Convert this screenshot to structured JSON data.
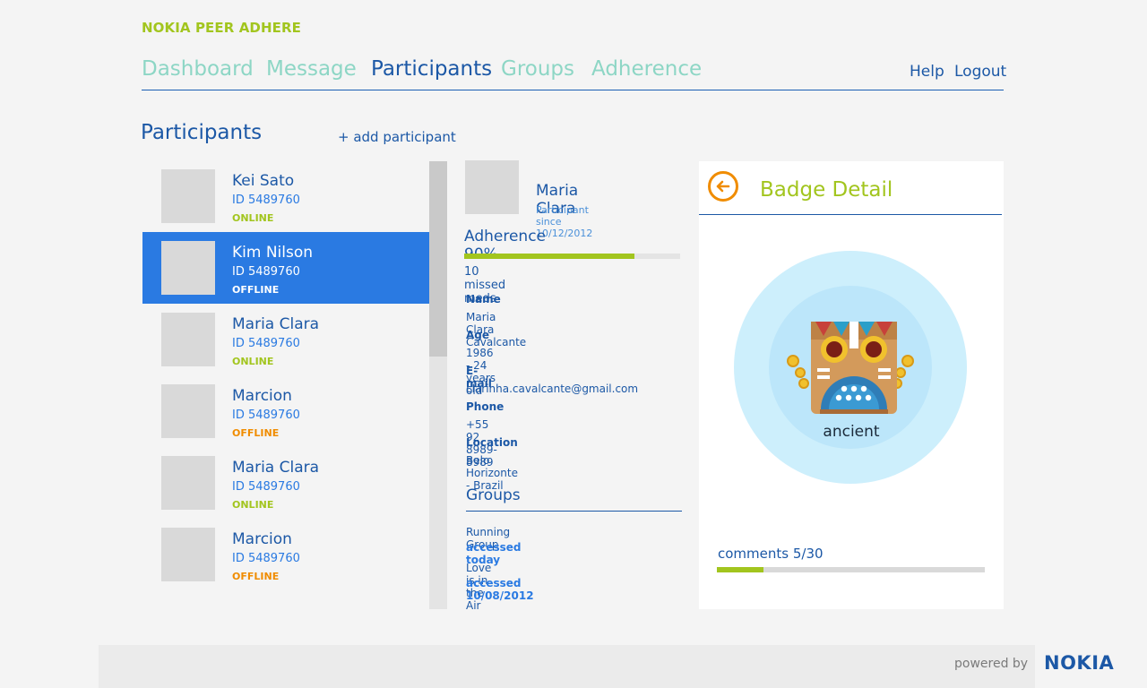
{
  "app": {
    "title": "NOKIA PEER ADHERE"
  },
  "nav": {
    "tabs": [
      {
        "label": "Dashboard",
        "active": false
      },
      {
        "label": "Message",
        "active": false
      },
      {
        "label": "Participants",
        "active": true
      },
      {
        "label": "Groups",
        "active": false
      },
      {
        "label": "Adherence",
        "active": false
      }
    ],
    "help": "Help",
    "logout": "Logout"
  },
  "participants": {
    "title": "Participants",
    "add_label": "+ add participant",
    "items": [
      {
        "name": "Kei Sato",
        "id": "ID 5489760",
        "status": "ONLINE",
        "selected": false
      },
      {
        "name": "Kim Nilson",
        "id": "ID 5489760",
        "status": "OFFLINE",
        "selected": true
      },
      {
        "name": "Maria Clara",
        "id": "ID 5489760",
        "status": "ONLINE",
        "selected": false
      },
      {
        "name": "Marcion",
        "id": "ID 5489760",
        "status": "OFFLINE",
        "selected": false
      },
      {
        "name": "Maria Clara",
        "id": "ID 5489760",
        "status": "ONLINE",
        "selected": false
      },
      {
        "name": "Marcion",
        "id": "ID 5489760",
        "status": "OFFLINE",
        "selected": false
      }
    ]
  },
  "detail": {
    "name": "Maria Clara",
    "since": "Participant since 10/12/2012",
    "adherence_label": "Adherence 90%",
    "adherence_percent": 79,
    "missed": "10 missed meds",
    "fields": [
      {
        "label": "Name",
        "value": "Maria Clara Cavalcante"
      },
      {
        "label": "Age",
        "value": "1986 - 24 years old"
      },
      {
        "label": "E-mail",
        "value": "clarinha.cavalcante@gmail.com"
      },
      {
        "label": "Phone",
        "value": "+55 92 8989-8989"
      },
      {
        "label": "Location",
        "value": "Belo Horizonte - Brazil"
      }
    ],
    "groups_title": "Groups",
    "groups": [
      {
        "name": "Running Group",
        "accessed": "accessed today"
      },
      {
        "name": "Love is in the Air",
        "accessed": "accessed 10/08/2012"
      }
    ]
  },
  "badge": {
    "title": "Badge Detail",
    "name": "ancient",
    "comments_label": "comments 5/30",
    "comments_fraction": 0.173
  },
  "footer": {
    "powered_by": "powered by",
    "brand": "NOKIA"
  },
  "colors": {
    "brand_blue": "#1c58a6",
    "accent_green": "#a2c51e",
    "offline_orange": "#f08c00",
    "selection_blue": "#2a7ae2"
  }
}
